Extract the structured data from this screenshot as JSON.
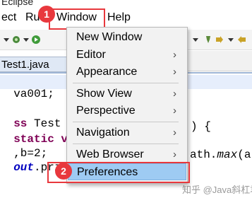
{
  "window": {
    "title_fragment": "Eclipse"
  },
  "menubar": {
    "items": [
      "ect",
      "Ru",
      "Window",
      "Help"
    ]
  },
  "annotations": {
    "step1": "1",
    "step2": "2"
  },
  "editor": {
    "tab_label": "Test1.java",
    "lines": [
      {
        "text": "va001;"
      },
      {
        "kw": "ss",
        "rest": " Test {"
      },
      {
        "kw": "static v",
        "rest": ""
      },
      {
        "rest": ",b=2;"
      },
      {
        "fld": "out",
        "rest": ".prin"
      }
    ],
    "right_lines": [
      ") {",
      "ath.",
      "max",
      "(a,"
    ]
  },
  "window_menu": {
    "items": [
      {
        "label": "New Window",
        "submenu": false
      },
      {
        "label": "Editor",
        "submenu": true
      },
      {
        "label": "Appearance",
        "submenu": true
      },
      {
        "label": "Show View",
        "submenu": true
      },
      {
        "label": "Perspective",
        "submenu": true
      },
      {
        "label": "Navigation",
        "submenu": true
      },
      {
        "label": "Web Browser",
        "submenu": true
      },
      {
        "label": "Preferences",
        "submenu": false,
        "selected": true
      }
    ]
  },
  "watermark": "知乎 @Java斜杠君",
  "colors": {
    "annotation_red": "#e8383d",
    "selection_blue": "#9ecbf3",
    "keyword": "#7f0055",
    "field": "#0000c0"
  }
}
